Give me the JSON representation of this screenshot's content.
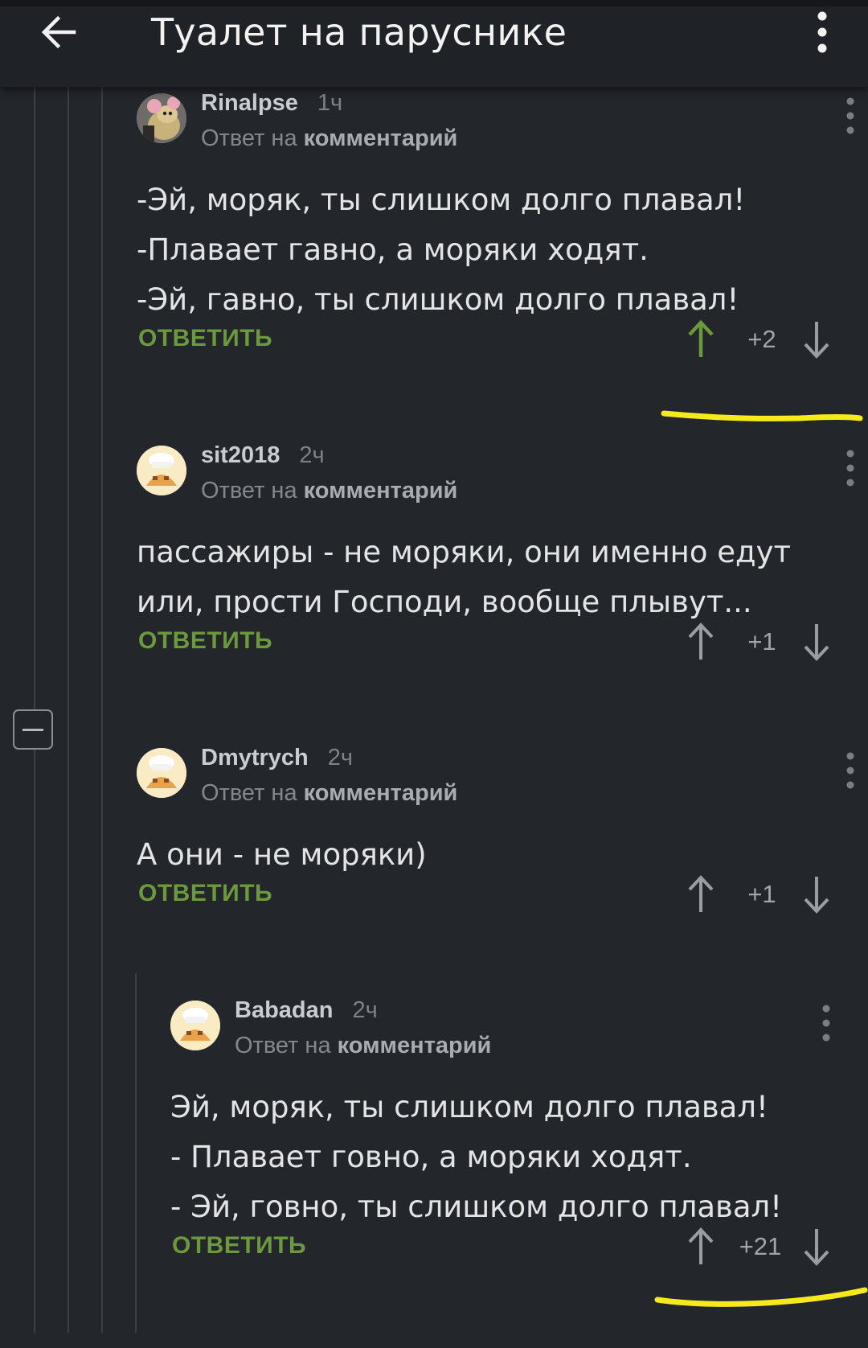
{
  "header": {
    "title": "Туалет на паруснике"
  },
  "reply_prefix": "Ответ на",
  "reply_target": "комментарий",
  "reply_label": "ОТВЕТИТЬ",
  "colors": {
    "background": "#23262b",
    "topbar": "#1f2226",
    "accent_green": "#6b9a3b",
    "upvoted_arrow": "#6b9a3b",
    "highlight_yellow": "#f7ea1c"
  },
  "comments": [
    {
      "user": "Rinalpse",
      "time": "1ч",
      "lines": [
        "-Эй, моряк, ты слишком долго плавал!",
        "-Плавает гавно, а моряки ходят.",
        "-Эй, гавно, ты слишком долго плавал!"
      ],
      "score": "+2",
      "upvoted": true,
      "avatar_icon": "mouse-avatar-icon"
    },
    {
      "user": "sit2018",
      "time": "2ч",
      "lines": [
        "пассажиры - не моряки, они именно едут",
        "или, прости Господи, вообще плывут..."
      ],
      "score": "+1",
      "upvoted": false,
      "avatar_icon": "chef-avatar-icon"
    },
    {
      "user": "Dmytrych",
      "time": "2ч",
      "lines": [
        "А они - не моряки)"
      ],
      "score": "+1",
      "upvoted": false,
      "avatar_icon": "chef-avatar-icon"
    },
    {
      "user": "Babadan",
      "time": "2ч",
      "lines": [
        "Эй, моряк, ты слишком долго плавал!",
        "- Плавает говно, а моряки ходят.",
        "- Эй, говно, ты слишком долго плавал!"
      ],
      "score": "+21",
      "upvoted": false,
      "avatar_icon": "chef-avatar-icon"
    }
  ]
}
